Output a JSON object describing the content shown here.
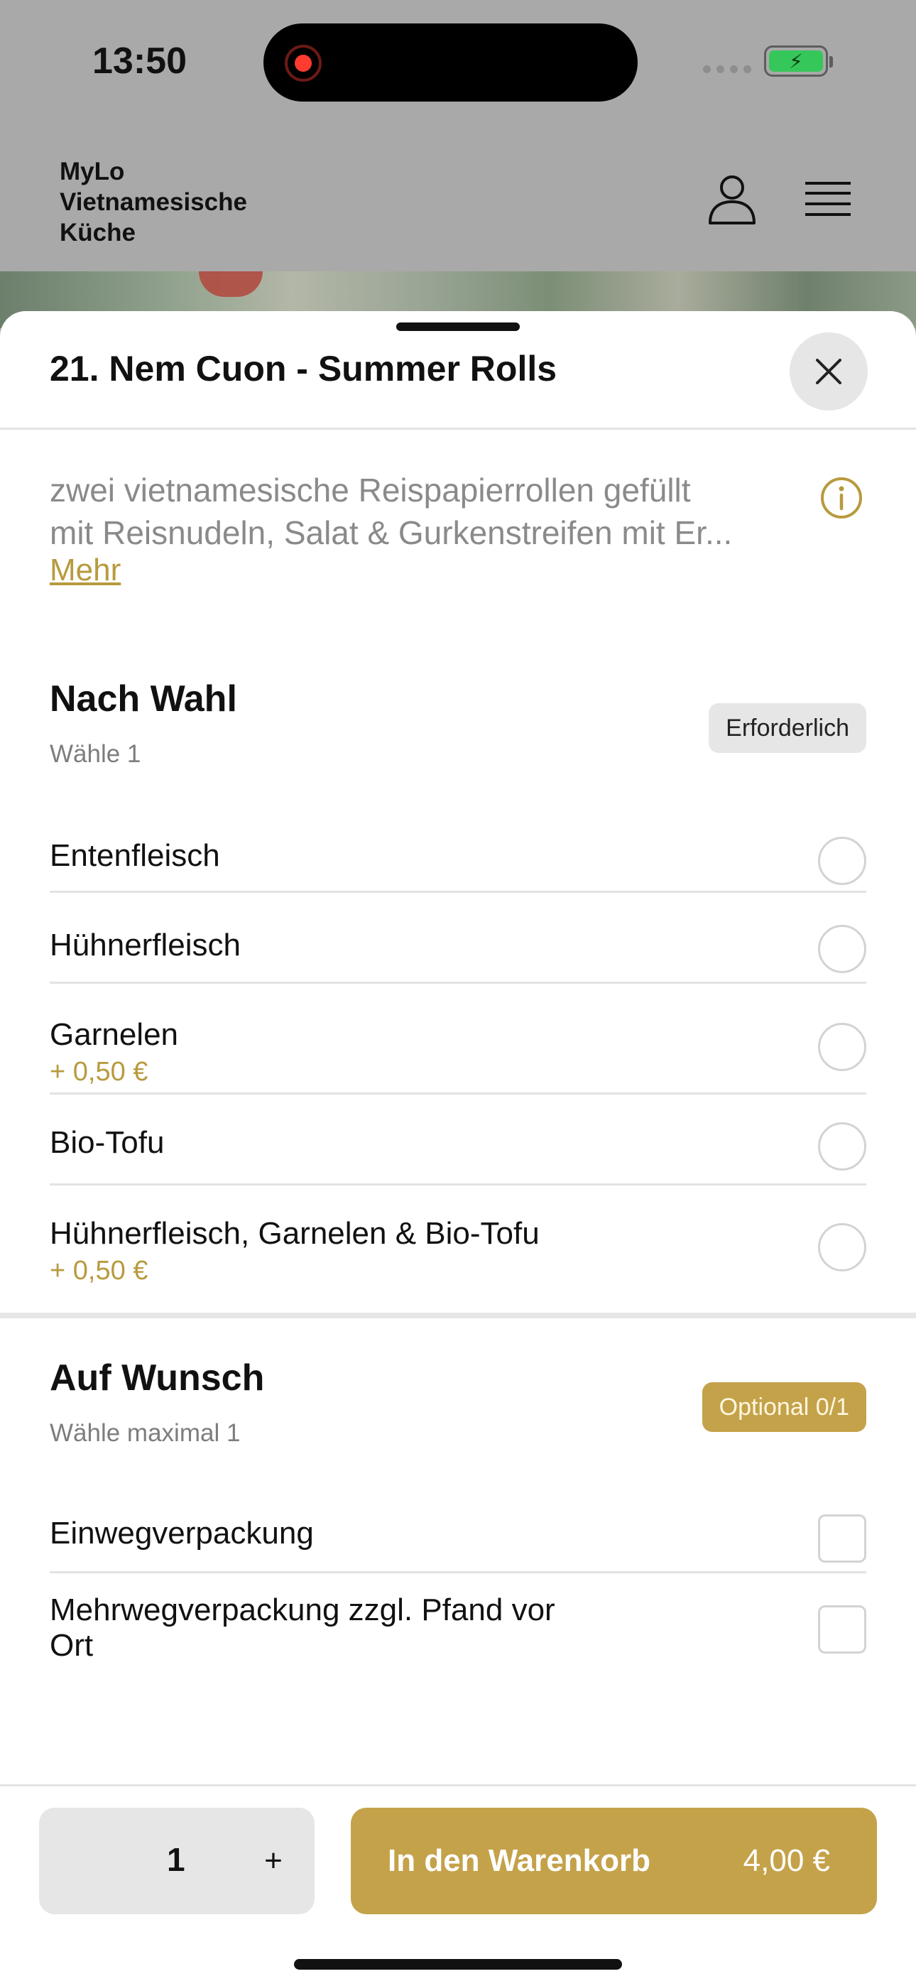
{
  "status_bar": {
    "time": "13:50"
  },
  "header": {
    "brand_lines": [
      "MyLo",
      "Vietnamesische",
      "Küche"
    ]
  },
  "sheet": {
    "title": "21. Nem Cuon - Summer Rolls",
    "description_lines": [
      "zwei vietnamesische Reispapierrollen gefüllt",
      "mit Reisnudeln, Salat & Gurkenstreifen mit Er..."
    ],
    "more_label": "Mehr"
  },
  "section_choice": {
    "title": "Nach Wahl",
    "subtitle": "Wähle 1",
    "badge": "Erforderlich",
    "options": [
      {
        "label": "Entenfleisch",
        "price": ""
      },
      {
        "label": "Hühnerfleisch",
        "price": ""
      },
      {
        "label": "Garnelen",
        "price": "+ 0,50 €"
      },
      {
        "label": "Bio-Tofu",
        "price": ""
      },
      {
        "label": "Hühnerfleisch, Garnelen & Bio-Tofu",
        "price": "+ 0,50 €"
      }
    ]
  },
  "section_request": {
    "title": "Auf Wunsch",
    "subtitle": "Wähle maximal 1",
    "badge": "Optional 0/1",
    "options": [
      {
        "label": "Einwegverpackung"
      },
      {
        "label": "Mehrwegverpackung zzgl. Pfand vor",
        "label_line2": "Ort"
      }
    ]
  },
  "bottom": {
    "quantity": "1",
    "plus": "+",
    "add_to_cart": "In den Warenkorb",
    "total": "4,00 €"
  },
  "colors": {
    "accent": "#c4a24a",
    "price_text": "#b89a3e",
    "dim_overlay": "#a9a9a9"
  }
}
